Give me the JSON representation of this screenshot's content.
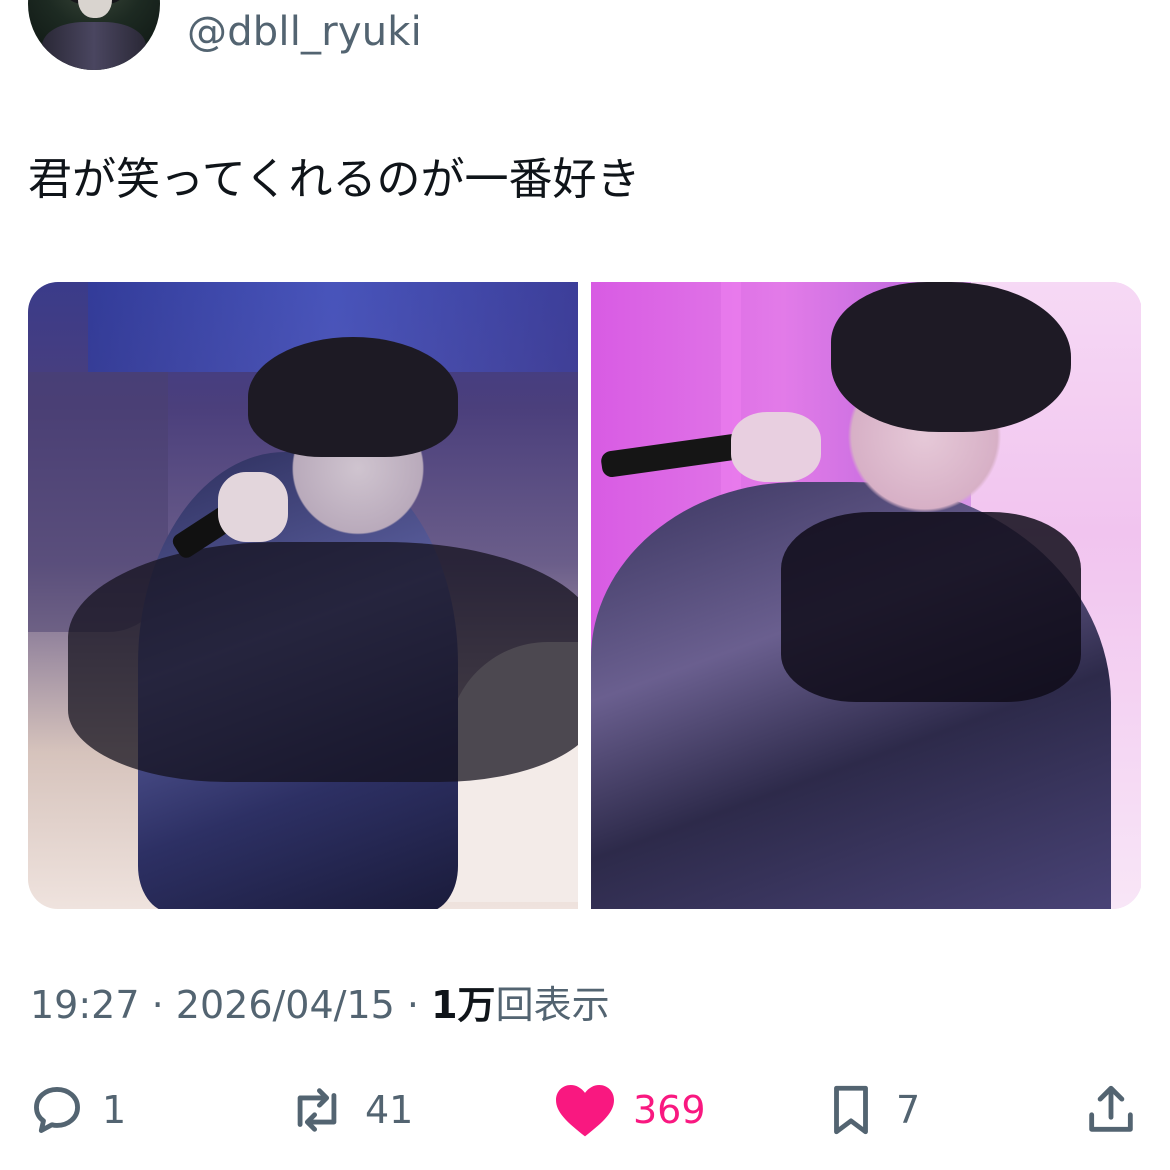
{
  "author": {
    "handle": "@dbll_ryuki"
  },
  "tweet": {
    "text": "君が笑ってくれるのが一番好き"
  },
  "metadata": {
    "time": "19:27",
    "date": "2026/04/15",
    "views_count": "1万",
    "views_label": "回表示",
    "separator": "·"
  },
  "actions": {
    "reply": {
      "icon": "reply-icon",
      "count": "1"
    },
    "retweet": {
      "icon": "retweet-icon",
      "count": "41"
    },
    "like": {
      "icon": "heart-icon",
      "count": "369",
      "color": "#f91880"
    },
    "bookmark": {
      "icon": "bookmark-icon",
      "count": "7"
    },
    "share": {
      "icon": "share-icon"
    }
  },
  "colors": {
    "secondary": "#536471",
    "primary": "#0f1419",
    "like": "#f91880"
  }
}
